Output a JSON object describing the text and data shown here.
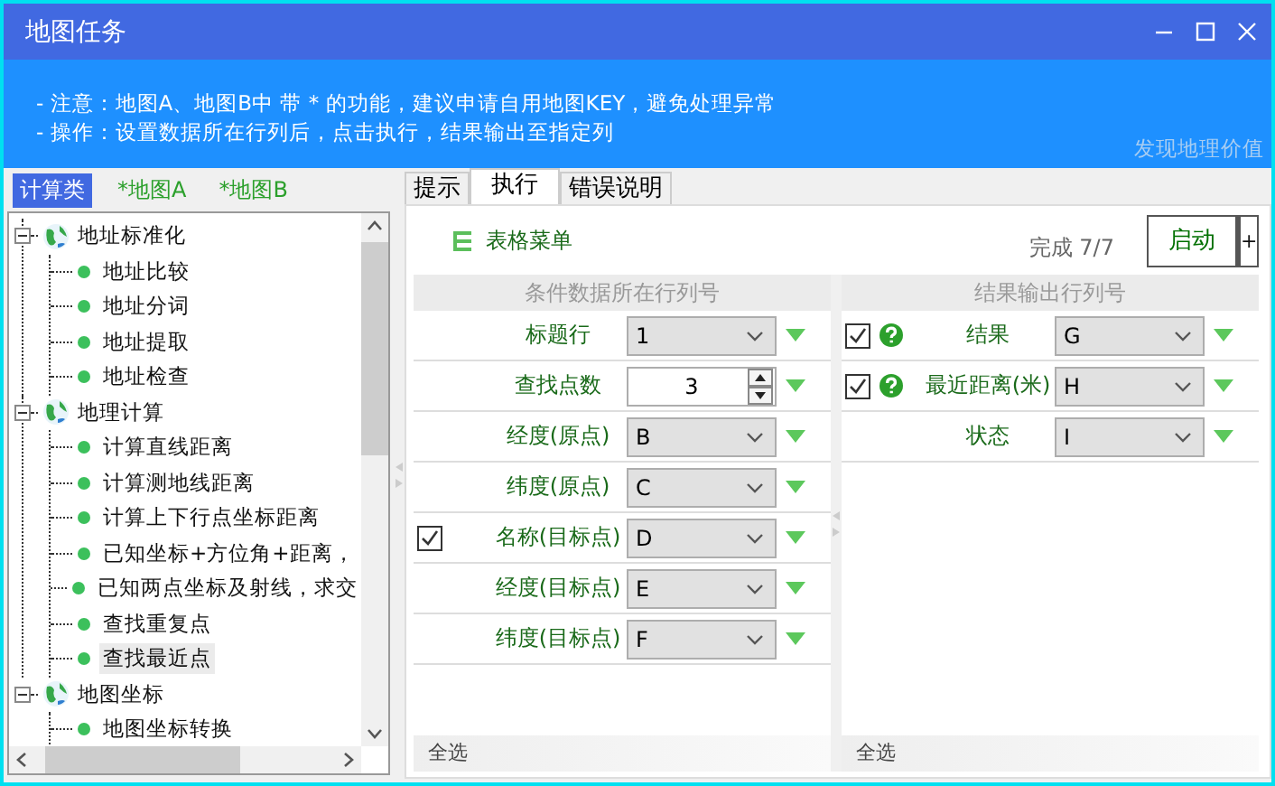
{
  "window": {
    "title": "地图任务"
  },
  "notes": [
    "- 注意：地图A、地图B中 带 * 的功能，建议申请自用地图KEY，避免处理异常",
    "- 操作：设置数据所在行列后，点击执行，结果输出至指定列"
  ],
  "slogan": "发现地理价值",
  "category_tabs": [
    {
      "label": "计算类",
      "selected": true
    },
    {
      "label": "*地图A",
      "selected": false
    },
    {
      "label": "*地图B",
      "selected": false
    }
  ],
  "tree": [
    {
      "label": "地址标准化",
      "expanded": true,
      "children": [
        {
          "label": "地址比较",
          "selected": false
        },
        {
          "label": "地址分词",
          "selected": false
        },
        {
          "label": "地址提取",
          "selected": false
        },
        {
          "label": "地址检查",
          "selected": false
        }
      ]
    },
    {
      "label": "地理计算",
      "expanded": true,
      "children": [
        {
          "label": "计算直线距离",
          "selected": false
        },
        {
          "label": "计算测地线距离",
          "selected": false
        },
        {
          "label": "计算上下行点坐标距离",
          "selected": false
        },
        {
          "label": "已知坐标+方位角+距离，",
          "selected": false
        },
        {
          "label": "已知两点坐标及射线，求交",
          "selected": false
        },
        {
          "label": "查找重复点",
          "selected": false
        },
        {
          "label": "查找最近点",
          "selected": true
        }
      ]
    },
    {
      "label": "地图坐标",
      "expanded": true,
      "children": [
        {
          "label": "地图坐标转换",
          "selected": false
        }
      ]
    }
  ],
  "tabs": [
    {
      "label": "提示",
      "selected": false
    },
    {
      "label": "执行",
      "selected": true
    },
    {
      "label": "错误说明",
      "selected": false
    }
  ],
  "toolbar": {
    "menu": "表格菜单",
    "progress": "完成 7/7",
    "start_button": "启动",
    "more_button": "+"
  },
  "condition_panel": {
    "header": "条件数据所在行列号",
    "footer": "全选",
    "rows": [
      {
        "kind": "select",
        "label": "标题行",
        "value": "1"
      },
      {
        "kind": "spin",
        "label": "查找点数",
        "value": "3"
      },
      {
        "kind": "select",
        "label": "经度(原点)",
        "value": "B"
      },
      {
        "kind": "select",
        "label": "纬度(原点)",
        "value": "C"
      },
      {
        "kind": "check",
        "label": "名称(目标点)",
        "value": "D",
        "checked": true
      },
      {
        "kind": "select",
        "label": "经度(目标点)",
        "value": "E"
      },
      {
        "kind": "select",
        "label": "纬度(目标点)",
        "value": "F"
      }
    ]
  },
  "result_panel": {
    "header": "结果输出行列号",
    "footer": "全选",
    "rows": [
      {
        "kind": "check-help",
        "label": "结果",
        "value": "G",
        "checked": true
      },
      {
        "kind": "check-help",
        "label": "最近距离(米)",
        "value": "H",
        "checked": true
      },
      {
        "kind": "select",
        "label": "状态",
        "value": "I"
      }
    ]
  }
}
